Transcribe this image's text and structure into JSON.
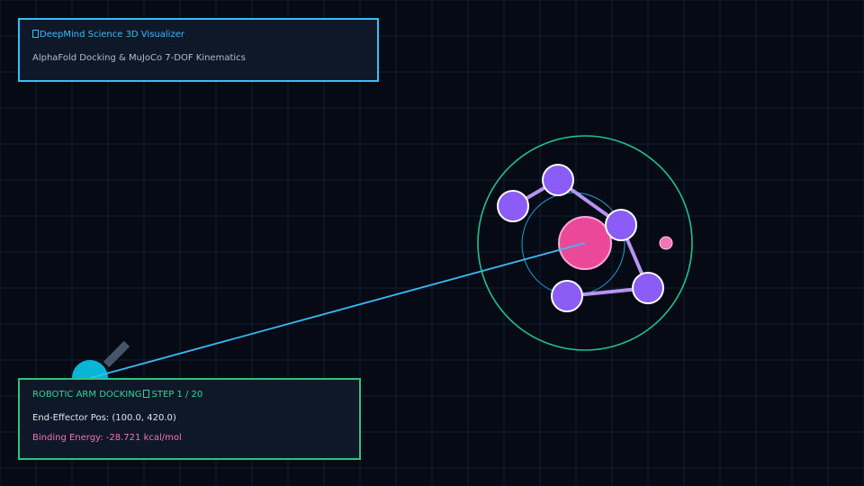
{
  "header": {
    "title": "DeepMind Science 3D Visualizer",
    "subtitle": "AlphaFold Docking & MuJoCo 7-DOF Kinematics"
  },
  "status": {
    "mode_label": "ROBOTIC ARM DOCKING",
    "step_text": "STEP 1 / 20",
    "position_text": "End-Effector Pos: (100.0, 420.0)",
    "energy_text": "Binding Energy: -28.721 kcal/mol"
  },
  "colors": {
    "background": "#050a14",
    "grid": "#142032",
    "panel_bg": "#0f1829",
    "header_border": "#38bdf8",
    "status_border": "#2ec27e",
    "title_text": "#38bdf8",
    "subtitle_text": "#b0bccb",
    "mode_text": "#34d399",
    "position_text": "#e5e7eb",
    "energy_text": "#f472b6",
    "outer_ring": "#22c08a",
    "inner_ring": "#1e9fd6",
    "ligand": "#ec4899",
    "atom": "#8b5cf6",
    "bond": "#b794f4",
    "beam": "#38bdf8",
    "arm_joint": "#06b6d4",
    "arm_link": "#475569"
  },
  "icons": {
    "title_glyph": "missing-glyph-icon",
    "separator_glyph": "missing-glyph-icon"
  }
}
